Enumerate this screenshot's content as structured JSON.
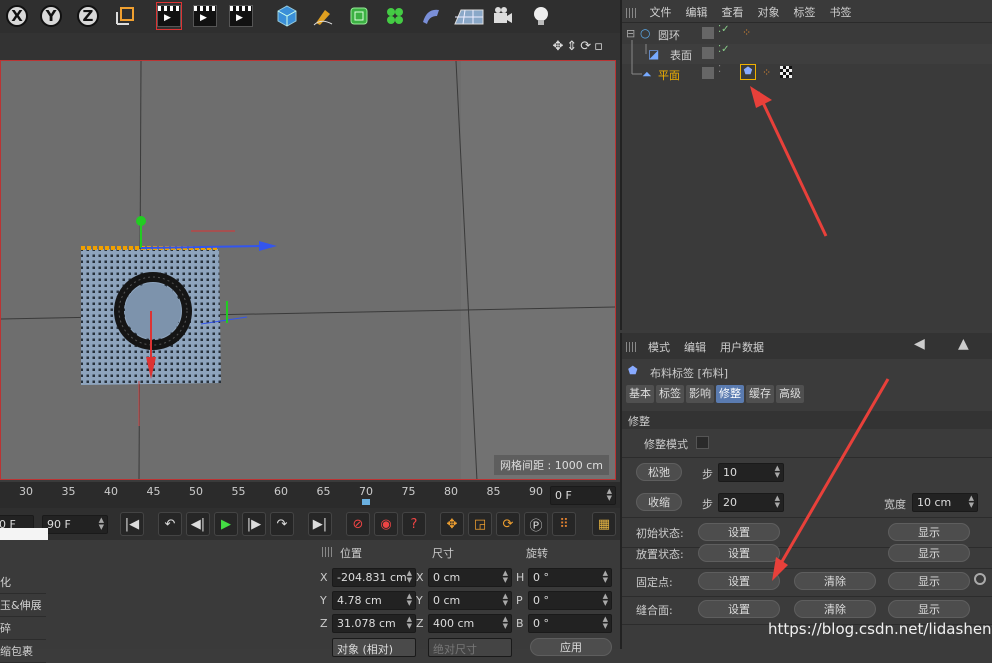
{
  "toolbar": {
    "axis_x": "X",
    "axis_y": "Y",
    "axis_z": "Z"
  },
  "viewport": {
    "grid_spacing": "网格间距 : 1000 cm"
  },
  "timeline": {
    "ticks": [
      "30",
      "35",
      "40",
      "45",
      "50",
      "55",
      "60",
      "65",
      "70",
      "75",
      "80",
      "85",
      "90"
    ],
    "current_frame": "0 F",
    "start_field": "0 F",
    "end_field": "90 F"
  },
  "left_list": {
    "items": [
      "化",
      "玉&伸展",
      "碎",
      "缩包裹"
    ]
  },
  "coords": {
    "headers": {
      "position": "位置",
      "size": "尺寸",
      "rotation": "旋转"
    },
    "rows": [
      {
        "axis": "X",
        "pos": "-204.831 cm",
        "size_axis": "X",
        "size": "0 cm",
        "rot_axis": "H",
        "rot": "0 °"
      },
      {
        "axis": "Y",
        "pos": "4.78 cm",
        "size_axis": "Y",
        "size": "0 cm",
        "rot_axis": "P",
        "rot": "0 °"
      },
      {
        "axis": "Z",
        "pos": "31.078 cm",
        "size_axis": "Z",
        "size": "400 cm",
        "rot_axis": "B",
        "rot": "0 °"
      }
    ],
    "mode": "对象 (相对)",
    "size_mode": "绝对尺寸",
    "apply": "应用"
  },
  "object_manager": {
    "menu": [
      "文件",
      "编辑",
      "查看",
      "对象",
      "标签",
      "书签"
    ],
    "objects": [
      {
        "name": "圆环"
      },
      {
        "name": "表面"
      },
      {
        "name": "平面"
      }
    ]
  },
  "attributes": {
    "menu": [
      "模式",
      "编辑",
      "用户数据"
    ],
    "title": "布料标签 [布料]",
    "tabs": [
      "基本",
      "标签",
      "影响",
      "修整",
      "缓存",
      "高级"
    ],
    "active_tab": "修整",
    "section": "修整",
    "dress_mode": "修整模式",
    "relax_btn": "松弛",
    "steps_label": "步",
    "relax_steps": "10",
    "shrink_btn": "收缩",
    "shrink_steps": "20",
    "width_label": "宽度",
    "width_value": "10 cm",
    "rows": [
      {
        "label": "初始状态:",
        "b1": "设置",
        "b3": "显示"
      },
      {
        "label": "放置状态:",
        "b1": "设置",
        "b3": "显示"
      },
      {
        "label": "固定点:",
        "b1": "设置",
        "b2": "清除",
        "b3": "显示"
      },
      {
        "label": "缝合面:",
        "b1": "设置",
        "b2": "清除",
        "b3": "显示"
      }
    ]
  },
  "watermark": "https://blog.csdn.net/lidashent",
  "colors": {
    "annotation_arrow": "#e8403a",
    "selected_tab": "#5a7bb0",
    "object_selected": "#f0b000"
  }
}
